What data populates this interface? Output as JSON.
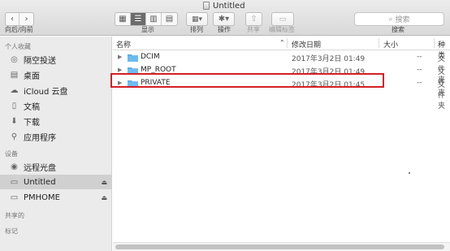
{
  "window": {
    "title": "Untitled"
  },
  "toolbar": {
    "nav_label": "向后/向前",
    "view_label": "显示",
    "arrange_label": "排列",
    "action_label": "操作",
    "share_label": "共享",
    "edit_tags_label": "编辑标签",
    "search_placeholder": "搜索",
    "search_label": "搜索"
  },
  "sidebar": {
    "favorites_header": "个人收藏",
    "favorites": [
      {
        "label": "隔空投送",
        "icon": "airdrop-icon"
      },
      {
        "label": "桌面",
        "icon": "desktop-icon"
      },
      {
        "label": "iCloud 云盘",
        "icon": "cloud-icon"
      },
      {
        "label": "文稿",
        "icon": "documents-icon"
      },
      {
        "label": "下载",
        "icon": "downloads-icon"
      },
      {
        "label": "应用程序",
        "icon": "applications-icon"
      }
    ],
    "devices_header": "设备",
    "devices": [
      {
        "label": "远程光盘",
        "icon": "remote-disc-icon"
      },
      {
        "label": "Untitled",
        "icon": "drive-icon",
        "selected": true
      },
      {
        "label": "PMHOME",
        "icon": "drive-icon"
      }
    ],
    "shared_header": "共享的",
    "tags_header": "标记"
  },
  "list": {
    "columns": {
      "name": "名称",
      "date_modified": "修改日期",
      "size": "大小",
      "kind": "种类"
    },
    "rows": [
      {
        "name": "DCIM",
        "date": "2017年3月2日 01:49",
        "size": "--",
        "kind": "文件夹"
      },
      {
        "name": "MP_ROOT",
        "date": "2017年3月2日 01:49",
        "size": "--",
        "kind": "文件夹"
      },
      {
        "name": "PRIVATE",
        "date": "2017年3月2日 01:45",
        "size": "--",
        "kind": "文件夹",
        "highlighted": true
      }
    ]
  },
  "colors": {
    "highlight_border": "#d41f26",
    "folder_blue": "#5aaee8",
    "selected_bg": "#d0d0d0"
  }
}
